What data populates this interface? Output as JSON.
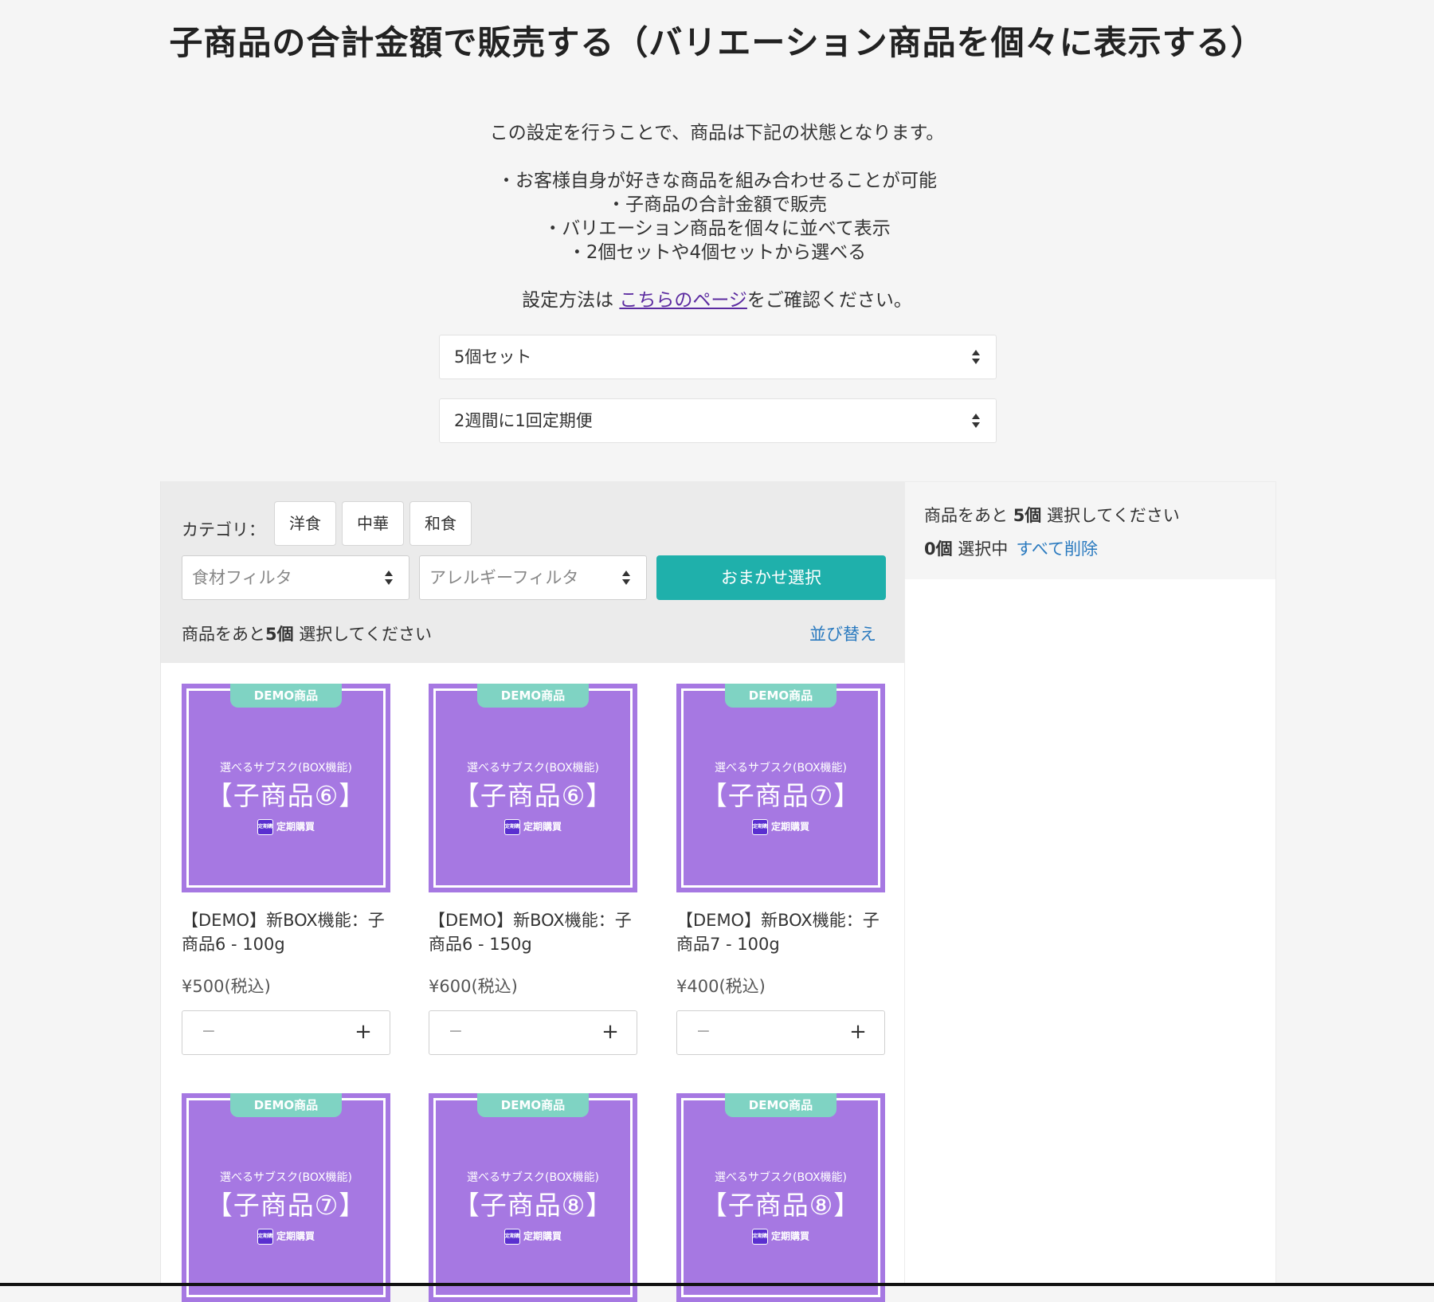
{
  "page": {
    "title": "子商品の合計金額で販売する（バリエーション商品を個々に表示する）",
    "intro_line1": "この設定を行うことで、商品は下記の状態となります。",
    "bullets": [
      "・お客様自身が好きな商品を組み合わせることが可能",
      "・子商品の合計金額で販売",
      "・バリエーション商品を個々に並べて表示",
      "・2個セットや4個セットから選べる"
    ],
    "settings_prefix": "設定方法は ",
    "settings_link": "こちらのページ",
    "settings_suffix": "をご確認ください。"
  },
  "selects": {
    "set_size": "5個セット",
    "delivery": "2週間に1回定期便"
  },
  "filters": {
    "category_label": "カテゴリ：",
    "categories": [
      "洋食",
      "中華",
      "和食"
    ],
    "ingredient_placeholder": "食材フィルタ",
    "allergy_placeholder": "アレルギーフィルタ",
    "omakase_label": "おまかせ選択",
    "remaining_prefix": "商品をあと",
    "remaining_count": "5個",
    "remaining_suffix": " 選択してください",
    "sort_label": "並び替え"
  },
  "summary": {
    "prefix": "商品をあと ",
    "count": "5個",
    "suffix": " 選択してください",
    "selected_count": "0個",
    "selected_label": " 選択中",
    "delete_all": "すべて削除"
  },
  "thumb_common": {
    "tag": "DEMO商品",
    "sub": "選べるサブスク(BOX機能)",
    "badge_icon_text": "定期購買",
    "badge": "定期購買"
  },
  "products": [
    {
      "big": "【子商品⑥】",
      "name": "【DEMO】新BOX機能：子商品6 - 100g",
      "price": "¥500(税込)"
    },
    {
      "big": "【子商品⑥】",
      "name": "【DEMO】新BOX機能：子商品6 - 150g",
      "price": "¥600(税込)"
    },
    {
      "big": "【子商品⑦】",
      "name": "【DEMO】新BOX機能：子商品7 - 100g",
      "price": "¥400(税込)"
    },
    {
      "big": "【子商品⑦】"
    },
    {
      "big": "【子商品⑧】"
    },
    {
      "big": "【子商品⑧】"
    }
  ],
  "stepper": {
    "minus": "−",
    "plus": "+"
  },
  "colors": {
    "accent": "#1fb0ab",
    "thumb_bg": "#a678e2",
    "tag_bg": "#7fd3c3",
    "link": "#2a7abf"
  }
}
